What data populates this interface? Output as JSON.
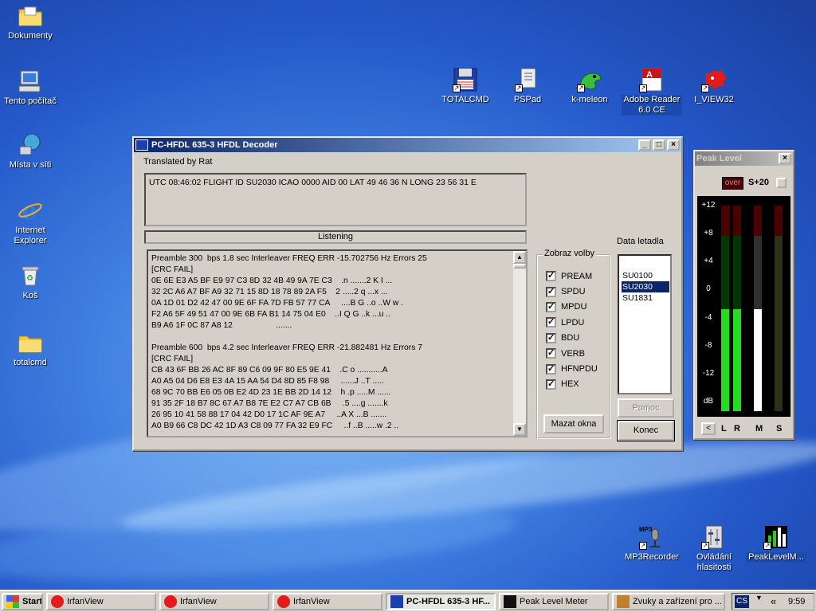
{
  "desktop": {
    "icons_left": [
      {
        "label": "Dokumenty",
        "icon": "folder-icon"
      },
      {
        "label": "Tento počítač",
        "icon": "computer-icon"
      },
      {
        "label": "Místa v síti",
        "icon": "network-icon"
      },
      {
        "label": "Internet Explorer",
        "icon": "internet-explorer-icon"
      },
      {
        "label": "Koš",
        "icon": "recycle-bin-icon"
      },
      {
        "label": "totalcmd",
        "icon": "folder-icon"
      }
    ],
    "icons_top": [
      {
        "label": "TOTALCMD",
        "icon": "floppy-disk-icon"
      },
      {
        "label": "PSPad",
        "icon": "pspad-icon"
      },
      {
        "label": "k-meleon",
        "icon": "chameleon-icon"
      },
      {
        "label": "Adobe Reader 6.0 CE",
        "icon": "adobe-reader-icon"
      },
      {
        "label": "I_VIEW32",
        "icon": "irfanview-icon"
      }
    ],
    "icons_bottom": [
      {
        "label": "MP3Recorder",
        "icon": "microphone-icon"
      },
      {
        "label": "Ovládání hlasitosti",
        "icon": "volume-control-icon"
      },
      {
        "label": "PeakLevelM...",
        "icon": "level-meter-icon"
      }
    ]
  },
  "decoder": {
    "title": "PC-HFDL 635-3 HFDL Decoder",
    "subtitle": "Translated by Rat",
    "status_line": "UTC 08:46:02  FLIGHT ID SU2030 ICAO 0000 AID 00 LAT 49 46 36  N  LONG 23 56 31  E",
    "listening": "Listening",
    "log_lines": [
      "Preamble 300  bps 1.8 sec Interleaver FREQ ERR -15.702756 Hz Errors 25",
      "[CRC FAIL]",
      "0E 6E E3 A5 BF E9 97 C3 8D 32 4B 49 9A 7E C3    .n .......2 K I ...",
      "32 2C A6 A7 BF A9 32 71 15 8D 18 78 89 2A F5    2 .....2 q ...x ...",
      "0A 1D 01 D2 42 47 00 9E 6F FA 7D FB 57 77 CA     ....B G ..o ..W w .",
      "F2 A6 5F 49 51 47 00 9E 6B FA B1 14 75 04 E0    ..I Q G ..k ...u ..",
      "B9 A6 1F 0C 87 A8 12                   .......",
      "",
      "Preamble 600  bps 4.2 sec Interleaver FREQ ERR -21.882481 Hz Errors 7",
      "[CRC FAIL]",
      "CB 43 6F BB 26 AC 8F 89 C6 09 9F 80 E5 9E 41    .C o ...........A",
      "A0 A5 04 D6 E8 E3 4A 15 AA 54 D4 8D 85 F8 98     ......J ..T .....",
      "68 9C 70 BB E6 05 0B E2 4D 23 1E BB 2D 14 12    h .p .....M ......",
      "91 35 2F 18 B7 8C 67 A7 B8 7E E2 C7 A7 CB 6B     .5 ....g .......k",
      "26 95 10 41 58 88 17 04 42 D0 17 1C AF 9E A7     ..A X ...B .......",
      "A0 B9 66 C8 DC 42 1D A3 C8 09 77 FA 32 E9 FC     ..f ..B .....w .2 .."
    ],
    "options_title": "Zobraz volby",
    "options": [
      "PREAM",
      "SPDU",
      "MPDU",
      "LPDU",
      "BDU",
      "VERB",
      "HFNPDU",
      "HEX"
    ],
    "aircraft_title": "Data letadla",
    "aircraft": [
      "SU0100",
      "SU2030",
      "SU1831"
    ],
    "selected_aircraft": "SU2030",
    "clear_button": "Mazat okna",
    "help_button": "Pomoc",
    "end_button": "Konec"
  },
  "peak": {
    "title": "Peak Level",
    "over": "over",
    "gain": "S+20",
    "scale": [
      "+12",
      "+8",
      "+4",
      "0",
      "-4",
      "-8",
      "-12",
      "dB"
    ],
    "channels": [
      "L",
      "R",
      "M",
      "S"
    ],
    "nav_left": "<"
  },
  "taskbar": {
    "start": "Start",
    "items": [
      {
        "label": "IrfanView",
        "icon": "irfanview-icon"
      },
      {
        "label": "IrfanView",
        "icon": "irfanview-icon"
      },
      {
        "label": "IrfanView",
        "icon": "irfanview-icon"
      },
      {
        "label": "PC-HFDL 635-3 HF...",
        "icon": "hfdl-icon"
      },
      {
        "label": "Peak Level Meter",
        "icon": "level-meter-icon"
      },
      {
        "label": "Zvuky a zařízení pro ...",
        "icon": "sound-icon"
      }
    ],
    "lang": "CS",
    "tray_arrows": "«",
    "clock": "9:59"
  }
}
